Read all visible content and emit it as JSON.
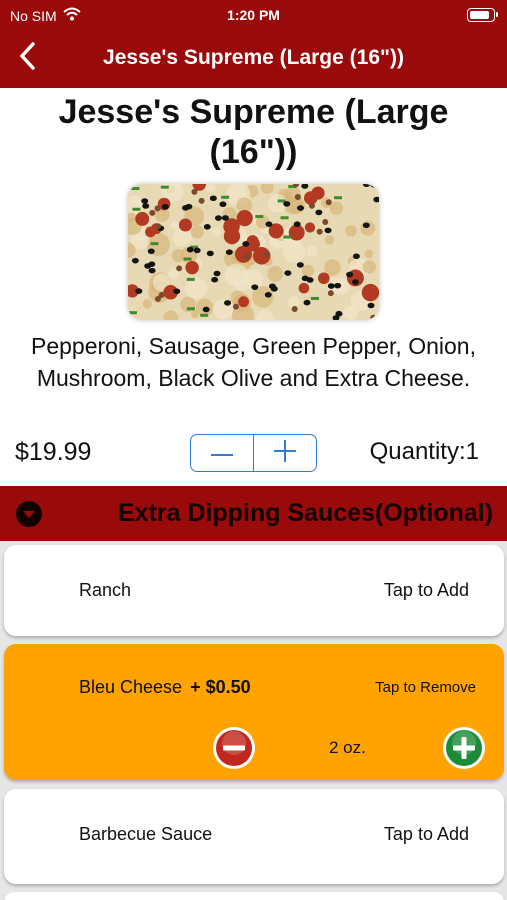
{
  "status_bar": {
    "carrier": "No SIM",
    "time": "1:20 PM",
    "battery_level": 0.9
  },
  "nav": {
    "title": "Jesse's Supreme (Large (16\"))"
  },
  "product": {
    "title": "Jesse's Supreme (Large (16\"))",
    "description": "Pepperoni, Sausage, Green Pepper, Onion, Mushroom, Black Olive and Extra Cheese.",
    "price": "$19.99",
    "quantity_label": "Quantity:1"
  },
  "section": {
    "title": "Extra Dipping Sauces(Optional)"
  },
  "options": [
    {
      "name": "Ranch",
      "action": "Tap to Add"
    },
    {
      "name": "Bleu Cheese",
      "addon_price": "+ $0.50",
      "action": "Tap to Remove",
      "amount": "2 oz."
    },
    {
      "name": "Barbecue Sauce",
      "action": "Tap to Add"
    }
  ],
  "colors": {
    "brand_red": "#9b0a0a",
    "selected_orange": "#ffa300",
    "minus_red": "#c0281e",
    "plus_green": "#1d8a3a",
    "stepper_blue": "#2f7bd6"
  },
  "icons": [
    "wifi-icon",
    "battery-icon",
    "back-chevron-icon",
    "minus-icon",
    "plus-icon",
    "collapse-arrow-icon",
    "remove-circle-icon",
    "add-circle-icon"
  ]
}
